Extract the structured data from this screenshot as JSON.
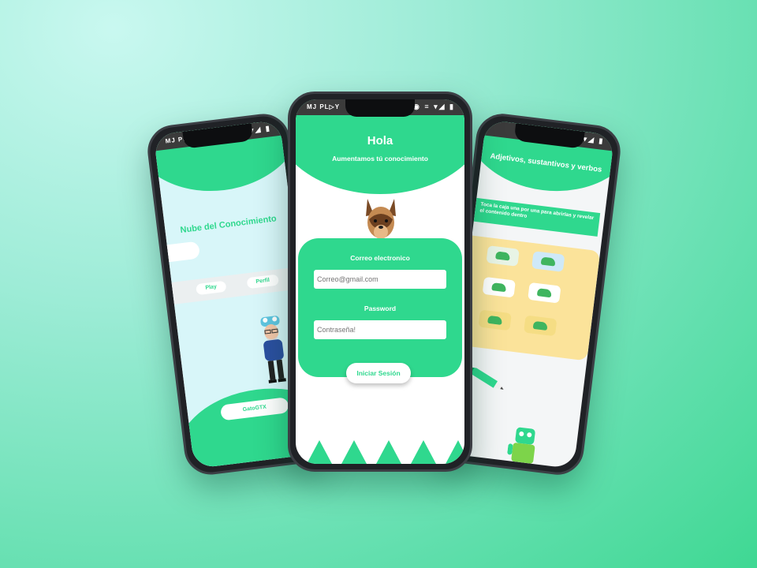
{
  "colors": {
    "accent": "#2fd88e",
    "status_bar": "#3b3b3b",
    "board": "#fbe39a"
  },
  "status_bar": {
    "brand": "MJ PL▷Y",
    "icons": "◉ ≡ ▾◢ ▮"
  },
  "center_screen": {
    "title": "Hola",
    "subtitle": "Aumentamos tú conocimiento",
    "email_label": "Correo electronico",
    "email_placeholder": "Correo@gmail.com",
    "password_label": "Password",
    "password_placeholder": "Contraseña!",
    "login_button": "Iniciar Sesión"
  },
  "left_screen": {
    "title": "Nube del Conocimiento",
    "tabs": [
      "Play",
      "Perfil"
    ],
    "username": "GatoGTX"
  },
  "right_screen": {
    "title": "Adjetivos, sustantivos y verbos",
    "instruction": "Toca la caja una por una para abrirlas y revelar el contenido dentro"
  }
}
